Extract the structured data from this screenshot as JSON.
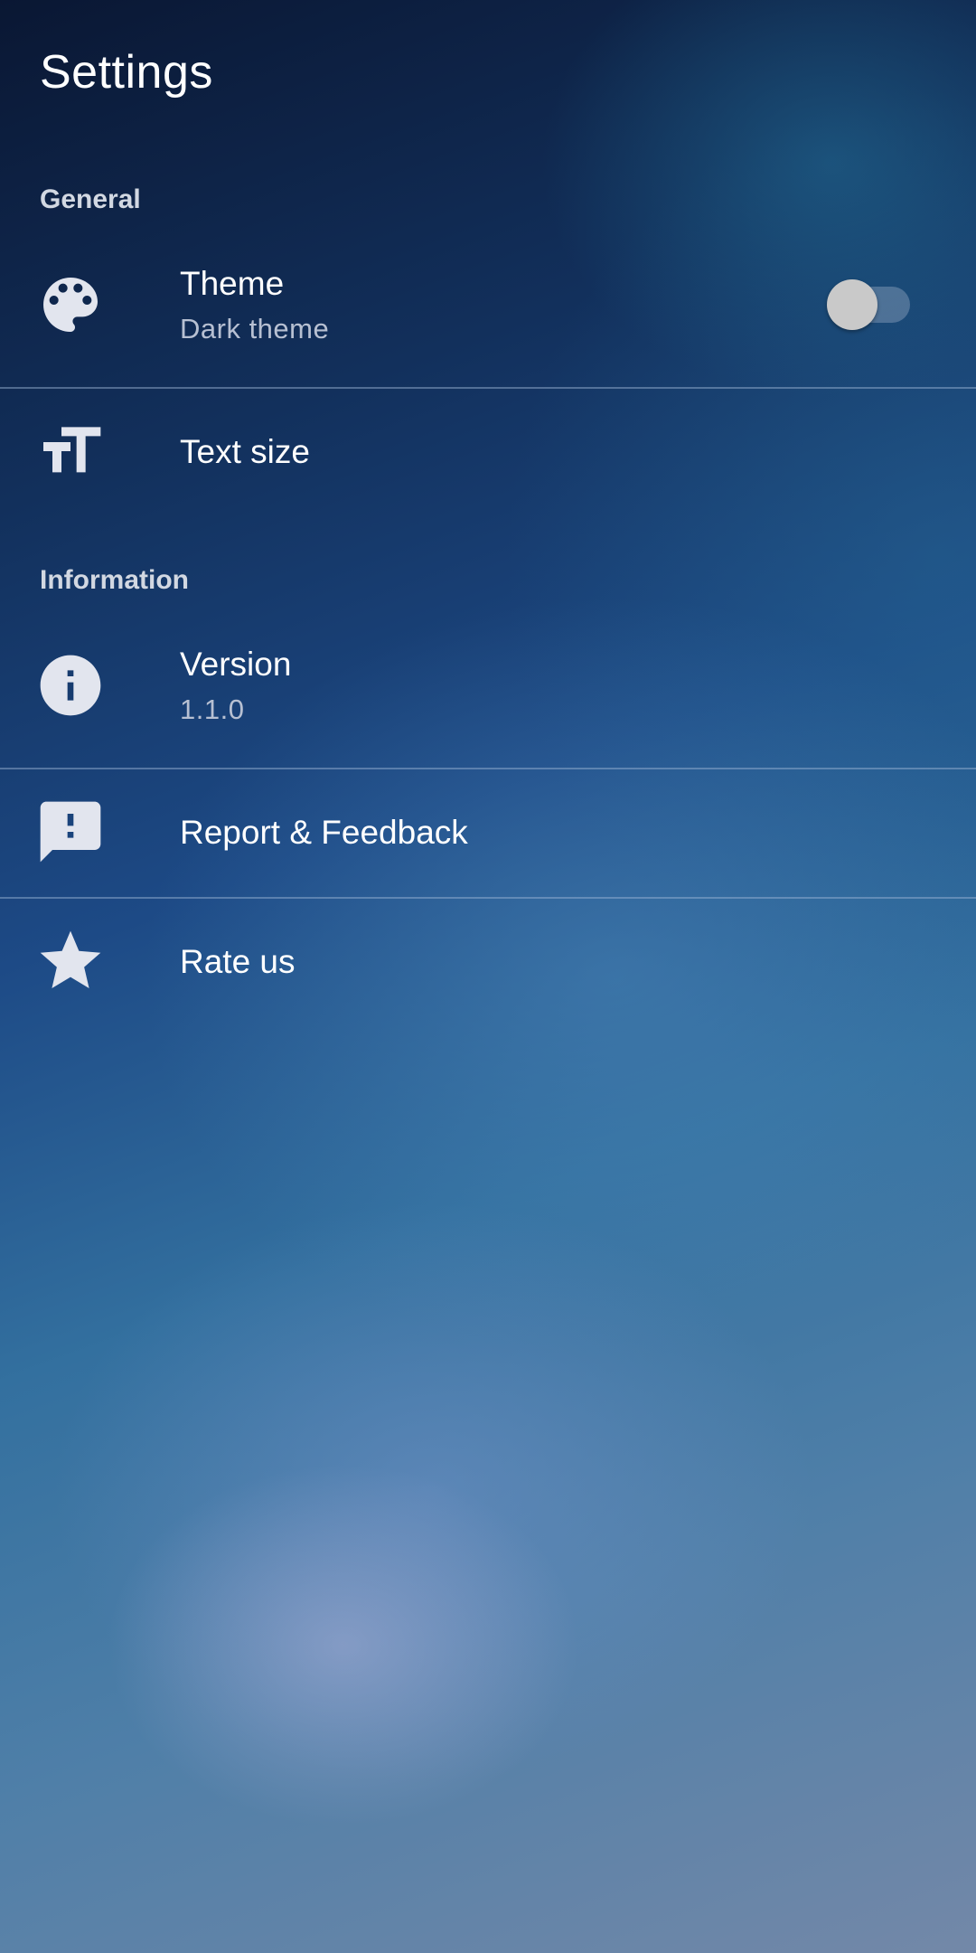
{
  "page": {
    "title": "Settings"
  },
  "sections": [
    {
      "header": "General",
      "items": [
        {
          "icon": "palette-icon",
          "label": "Theme",
          "sublabel": "Dark theme",
          "toggle_on": false
        },
        {
          "icon": "text-size-icon",
          "label": "Text size"
        }
      ]
    },
    {
      "header": "Information",
      "items": [
        {
          "icon": "info-icon",
          "label": "Version",
          "sublabel": "1.1.0"
        },
        {
          "icon": "feedback-icon",
          "label": "Report & Feedback"
        },
        {
          "icon": "star-icon",
          "label": "Rate us"
        }
      ]
    }
  ],
  "colors": {
    "icon": "#e2e5ee",
    "section_header": "#d2d8e2",
    "sublabel": "#b7c0d2",
    "toggle_thumb_off": "#c9c9c9"
  }
}
